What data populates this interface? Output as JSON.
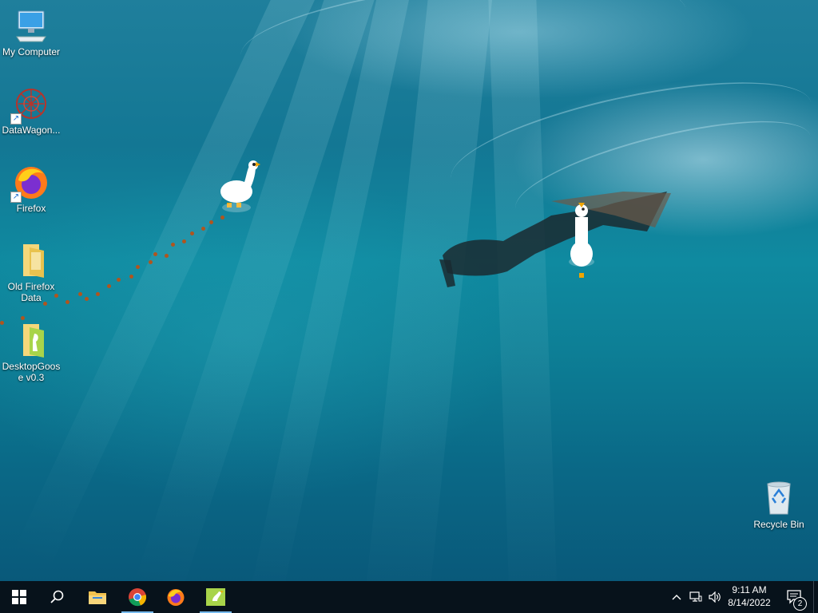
{
  "desktop": {
    "icons": [
      {
        "label": "My Computer",
        "icon": "computer-icon"
      },
      {
        "label": "DataWagon...",
        "icon": "datawagon-icon"
      },
      {
        "label": "Firefox",
        "icon": "firefox-icon"
      },
      {
        "label": "Old Firefox Data",
        "icon": "folder-icon"
      },
      {
        "label": "DesktopGoose v0.3",
        "icon": "folder-goose-icon"
      },
      {
        "label": "Recycle Bin",
        "icon": "recycle-bin-icon"
      }
    ]
  },
  "taskbar": {
    "apps": [
      "start-icon",
      "search-icon",
      "file-explorer-icon",
      "chrome-icon",
      "firefox-icon",
      "desktop-goose-icon"
    ],
    "clock_time": "9:11 AM",
    "clock_date": "8/14/2022",
    "notification_count": "2"
  },
  "colors": {
    "taskbar": "#07121b",
    "active_indicator": "#76b9ed",
    "goose_beak": "#f0a500",
    "goose_footprints": "#b0551e"
  }
}
